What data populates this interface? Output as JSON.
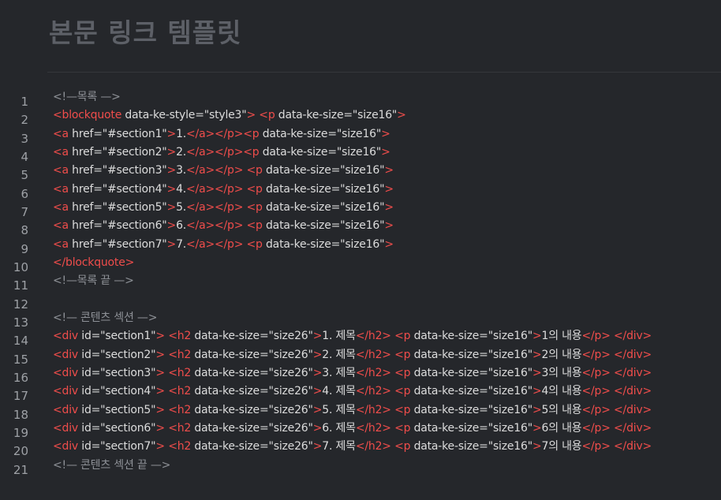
{
  "page": {
    "title": "본문 링크 템플릿"
  },
  "colors": {
    "background": "#25272b",
    "tag": "#f04d4b",
    "text": "#dcdcdc",
    "comment": "#8e9197",
    "line_number": "#9ea1a6",
    "title": "#5d6067"
  },
  "code": {
    "lines": [
      {
        "n": "1",
        "segs": [
          {
            "t": "<!—목록 —>",
            "k": "comment"
          }
        ]
      },
      {
        "n": "2",
        "segs": [
          {
            "t": "<blockquote",
            "k": "tag"
          },
          {
            "t": " data-ke-style=",
            "k": "attr"
          },
          {
            "t": "\"style3\"",
            "k": "val"
          },
          {
            "t": ">",
            "k": "tag"
          },
          {
            "t": " ",
            "k": "plain"
          },
          {
            "t": "<p",
            "k": "tag"
          },
          {
            "t": " data-ke-size=",
            "k": "attr"
          },
          {
            "t": "\"size16\"",
            "k": "val"
          },
          {
            "t": ">",
            "k": "tag"
          }
        ]
      },
      {
        "n": "3",
        "segs": [
          {
            "t": "<a",
            "k": "tag"
          },
          {
            "t": " href=",
            "k": "attr"
          },
          {
            "t": "\"#section1\"",
            "k": "val"
          },
          {
            "t": ">",
            "k": "tag"
          },
          {
            "t": "1.",
            "k": "plain"
          },
          {
            "t": "</a></p><p",
            "k": "tag"
          },
          {
            "t": " data-ke-size=",
            "k": "attr"
          },
          {
            "t": "\"size16\"",
            "k": "val"
          },
          {
            "t": ">",
            "k": "tag"
          }
        ]
      },
      {
        "n": "4",
        "segs": [
          {
            "t": "<a",
            "k": "tag"
          },
          {
            "t": " href=",
            "k": "attr"
          },
          {
            "t": "\"#section2\"",
            "k": "val"
          },
          {
            "t": ">",
            "k": "tag"
          },
          {
            "t": "2.",
            "k": "plain"
          },
          {
            "t": "</a></p><p",
            "k": "tag"
          },
          {
            "t": " data-ke-size=",
            "k": "attr"
          },
          {
            "t": "\"size16\"",
            "k": "val"
          },
          {
            "t": ">",
            "k": "tag"
          }
        ]
      },
      {
        "n": "5",
        "segs": [
          {
            "t": "<a",
            "k": "tag"
          },
          {
            "t": " href=",
            "k": "attr"
          },
          {
            "t": "\"#section3\"",
            "k": "val"
          },
          {
            "t": ">",
            "k": "tag"
          },
          {
            "t": "3.",
            "k": "plain"
          },
          {
            "t": "</a></p>",
            "k": "tag"
          },
          {
            "t": " ",
            "k": "plain"
          },
          {
            "t": "<p",
            "k": "tag"
          },
          {
            "t": " data-ke-size=",
            "k": "attr"
          },
          {
            "t": "\"size16\"",
            "k": "val"
          },
          {
            "t": ">",
            "k": "tag"
          }
        ]
      },
      {
        "n": "6",
        "segs": [
          {
            "t": "<a",
            "k": "tag"
          },
          {
            "t": " href=",
            "k": "attr"
          },
          {
            "t": "\"#section4\"",
            "k": "val"
          },
          {
            "t": ">",
            "k": "tag"
          },
          {
            "t": "4.",
            "k": "plain"
          },
          {
            "t": "</a></p>",
            "k": "tag"
          },
          {
            "t": " ",
            "k": "plain"
          },
          {
            "t": "<p",
            "k": "tag"
          },
          {
            "t": " data-ke-size=",
            "k": "attr"
          },
          {
            "t": "\"size16\"",
            "k": "val"
          },
          {
            "t": ">",
            "k": "tag"
          }
        ]
      },
      {
        "n": "7",
        "segs": [
          {
            "t": "<a",
            "k": "tag"
          },
          {
            "t": " href=",
            "k": "attr"
          },
          {
            "t": "\"#section5\"",
            "k": "val"
          },
          {
            "t": ">",
            "k": "tag"
          },
          {
            "t": "5.",
            "k": "plain"
          },
          {
            "t": "</a></p>",
            "k": "tag"
          },
          {
            "t": " ",
            "k": "plain"
          },
          {
            "t": "<p",
            "k": "tag"
          },
          {
            "t": " data-ke-size=",
            "k": "attr"
          },
          {
            "t": "\"size16\"",
            "k": "val"
          },
          {
            "t": ">",
            "k": "tag"
          }
        ]
      },
      {
        "n": "8",
        "segs": [
          {
            "t": "<a",
            "k": "tag"
          },
          {
            "t": " href=",
            "k": "attr"
          },
          {
            "t": "\"#section6\"",
            "k": "val"
          },
          {
            "t": ">",
            "k": "tag"
          },
          {
            "t": "6.",
            "k": "plain"
          },
          {
            "t": "</a></p>",
            "k": "tag"
          },
          {
            "t": " ",
            "k": "plain"
          },
          {
            "t": "<p",
            "k": "tag"
          },
          {
            "t": " data-ke-size=",
            "k": "attr"
          },
          {
            "t": "\"size16\"",
            "k": "val"
          },
          {
            "t": ">",
            "k": "tag"
          }
        ]
      },
      {
        "n": "9",
        "segs": [
          {
            "t": "<a",
            "k": "tag"
          },
          {
            "t": " href=",
            "k": "attr"
          },
          {
            "t": "\"#section7\"",
            "k": "val"
          },
          {
            "t": ">",
            "k": "tag"
          },
          {
            "t": "7.",
            "k": "plain"
          },
          {
            "t": "</a></p>",
            "k": "tag"
          },
          {
            "t": " ",
            "k": "plain"
          },
          {
            "t": "<p",
            "k": "tag"
          },
          {
            "t": " data-ke-size=",
            "k": "attr"
          },
          {
            "t": "\"size16\"",
            "k": "val"
          },
          {
            "t": ">",
            "k": "tag"
          }
        ]
      },
      {
        "n": "10",
        "segs": [
          {
            "t": "</blockquote>",
            "k": "tag"
          }
        ]
      },
      {
        "n": "11",
        "segs": [
          {
            "t": "<!—목록 끝 —>",
            "k": "comment"
          }
        ]
      },
      {
        "n": "12",
        "segs": []
      },
      {
        "n": "13",
        "segs": [
          {
            "t": "<!— 콘텐츠 섹션 —>",
            "k": "comment"
          }
        ]
      },
      {
        "n": "14",
        "segs": [
          {
            "t": "<div",
            "k": "tag"
          },
          {
            "t": " id=",
            "k": "attr"
          },
          {
            "t": "\"section1\"",
            "k": "val"
          },
          {
            "t": ">",
            "k": "tag"
          },
          {
            "t": " ",
            "k": "plain"
          },
          {
            "t": "<h2",
            "k": "tag"
          },
          {
            "t": " data-ke-size=",
            "k": "attr"
          },
          {
            "t": "\"size26\"",
            "k": "val"
          },
          {
            "t": ">",
            "k": "tag"
          },
          {
            "t": "1. 제목",
            "k": "plain"
          },
          {
            "t": "</h2>",
            "k": "tag"
          },
          {
            "t": " ",
            "k": "plain"
          },
          {
            "t": "<p",
            "k": "tag"
          },
          {
            "t": " data-ke-size=",
            "k": "attr"
          },
          {
            "t": "\"size16\"",
            "k": "val"
          },
          {
            "t": ">",
            "k": "tag"
          },
          {
            "t": "1의 내용",
            "k": "plain"
          },
          {
            "t": "</p>",
            "k": "tag"
          },
          {
            "t": " ",
            "k": "plain"
          },
          {
            "t": "</div>",
            "k": "tag"
          }
        ]
      },
      {
        "n": "15",
        "segs": [
          {
            "t": "<div",
            "k": "tag"
          },
          {
            "t": " id=",
            "k": "attr"
          },
          {
            "t": "\"section2\"",
            "k": "val"
          },
          {
            "t": ">",
            "k": "tag"
          },
          {
            "t": " ",
            "k": "plain"
          },
          {
            "t": "<h2",
            "k": "tag"
          },
          {
            "t": " data-ke-size=",
            "k": "attr"
          },
          {
            "t": "\"size26\"",
            "k": "val"
          },
          {
            "t": ">",
            "k": "tag"
          },
          {
            "t": "2. 제목",
            "k": "plain"
          },
          {
            "t": "</h2>",
            "k": "tag"
          },
          {
            "t": " ",
            "k": "plain"
          },
          {
            "t": "<p",
            "k": "tag"
          },
          {
            "t": " data-ke-size=",
            "k": "attr"
          },
          {
            "t": "\"size16\"",
            "k": "val"
          },
          {
            "t": ">",
            "k": "tag"
          },
          {
            "t": "2의 내용",
            "k": "plain"
          },
          {
            "t": "</p>",
            "k": "tag"
          },
          {
            "t": " ",
            "k": "plain"
          },
          {
            "t": "</div>",
            "k": "tag"
          }
        ]
      },
      {
        "n": "16",
        "segs": [
          {
            "t": "<div",
            "k": "tag"
          },
          {
            "t": " id=",
            "k": "attr"
          },
          {
            "t": "\"section3\"",
            "k": "val"
          },
          {
            "t": ">",
            "k": "tag"
          },
          {
            "t": " ",
            "k": "plain"
          },
          {
            "t": "<h2",
            "k": "tag"
          },
          {
            "t": " data-ke-size=",
            "k": "attr"
          },
          {
            "t": "\"size26\"",
            "k": "val"
          },
          {
            "t": ">",
            "k": "tag"
          },
          {
            "t": "3. 제목",
            "k": "plain"
          },
          {
            "t": "</h2>",
            "k": "tag"
          },
          {
            "t": " ",
            "k": "plain"
          },
          {
            "t": "<p",
            "k": "tag"
          },
          {
            "t": " data-ke-size=",
            "k": "attr"
          },
          {
            "t": "\"size16\"",
            "k": "val"
          },
          {
            "t": ">",
            "k": "tag"
          },
          {
            "t": "3의 내용",
            "k": "plain"
          },
          {
            "t": "</p>",
            "k": "tag"
          },
          {
            "t": " ",
            "k": "plain"
          },
          {
            "t": "</div>",
            "k": "tag"
          }
        ]
      },
      {
        "n": "17",
        "segs": [
          {
            "t": "<div",
            "k": "tag"
          },
          {
            "t": " id=",
            "k": "attr"
          },
          {
            "t": "\"section4\"",
            "k": "val"
          },
          {
            "t": ">",
            "k": "tag"
          },
          {
            "t": " ",
            "k": "plain"
          },
          {
            "t": "<h2",
            "k": "tag"
          },
          {
            "t": " data-ke-size=",
            "k": "attr"
          },
          {
            "t": "\"size26\"",
            "k": "val"
          },
          {
            "t": ">",
            "k": "tag"
          },
          {
            "t": "4. 제목",
            "k": "plain"
          },
          {
            "t": "</h2>",
            "k": "tag"
          },
          {
            "t": " ",
            "k": "plain"
          },
          {
            "t": "<p",
            "k": "tag"
          },
          {
            "t": " data-ke-size=",
            "k": "attr"
          },
          {
            "t": "\"size16\"",
            "k": "val"
          },
          {
            "t": ">",
            "k": "tag"
          },
          {
            "t": "4의 내용",
            "k": "plain"
          },
          {
            "t": "</p>",
            "k": "tag"
          },
          {
            "t": " ",
            "k": "plain"
          },
          {
            "t": "</div>",
            "k": "tag"
          }
        ]
      },
      {
        "n": "18",
        "segs": [
          {
            "t": "<div",
            "k": "tag"
          },
          {
            "t": " id=",
            "k": "attr"
          },
          {
            "t": "\"section5\"",
            "k": "val"
          },
          {
            "t": ">",
            "k": "tag"
          },
          {
            "t": " ",
            "k": "plain"
          },
          {
            "t": "<h2",
            "k": "tag"
          },
          {
            "t": " data-ke-size=",
            "k": "attr"
          },
          {
            "t": "\"size26\"",
            "k": "val"
          },
          {
            "t": ">",
            "k": "tag"
          },
          {
            "t": "5. 제목",
            "k": "plain"
          },
          {
            "t": "</h2>",
            "k": "tag"
          },
          {
            "t": " ",
            "k": "plain"
          },
          {
            "t": "<p",
            "k": "tag"
          },
          {
            "t": " data-ke-size=",
            "k": "attr"
          },
          {
            "t": "\"size16\"",
            "k": "val"
          },
          {
            "t": ">",
            "k": "tag"
          },
          {
            "t": "5의 내용",
            "k": "plain"
          },
          {
            "t": "</p>",
            "k": "tag"
          },
          {
            "t": " ",
            "k": "plain"
          },
          {
            "t": "</div>",
            "k": "tag"
          }
        ]
      },
      {
        "n": "19",
        "segs": [
          {
            "t": "<div",
            "k": "tag"
          },
          {
            "t": " id=",
            "k": "attr"
          },
          {
            "t": "\"section6\"",
            "k": "val"
          },
          {
            "t": ">",
            "k": "tag"
          },
          {
            "t": " ",
            "k": "plain"
          },
          {
            "t": "<h2",
            "k": "tag"
          },
          {
            "t": " data-ke-size=",
            "k": "attr"
          },
          {
            "t": "\"size26\"",
            "k": "val"
          },
          {
            "t": ">",
            "k": "tag"
          },
          {
            "t": "6. 제목",
            "k": "plain"
          },
          {
            "t": "</h2>",
            "k": "tag"
          },
          {
            "t": " ",
            "k": "plain"
          },
          {
            "t": "<p",
            "k": "tag"
          },
          {
            "t": " data-ke-size=",
            "k": "attr"
          },
          {
            "t": "\"size16\"",
            "k": "val"
          },
          {
            "t": ">",
            "k": "tag"
          },
          {
            "t": "6의 내용",
            "k": "plain"
          },
          {
            "t": "</p>",
            "k": "tag"
          },
          {
            "t": " ",
            "k": "plain"
          },
          {
            "t": "</div>",
            "k": "tag"
          }
        ]
      },
      {
        "n": "20",
        "segs": [
          {
            "t": "<div",
            "k": "tag"
          },
          {
            "t": " id=",
            "k": "attr"
          },
          {
            "t": "\"section7\"",
            "k": "val"
          },
          {
            "t": ">",
            "k": "tag"
          },
          {
            "t": " ",
            "k": "plain"
          },
          {
            "t": "<h2",
            "k": "tag"
          },
          {
            "t": " data-ke-size=",
            "k": "attr"
          },
          {
            "t": "\"size26\"",
            "k": "val"
          },
          {
            "t": ">",
            "k": "tag"
          },
          {
            "t": "7. 제목",
            "k": "plain"
          },
          {
            "t": "</h2>",
            "k": "tag"
          },
          {
            "t": " ",
            "k": "plain"
          },
          {
            "t": "<p",
            "k": "tag"
          },
          {
            "t": " data-ke-size=",
            "k": "attr"
          },
          {
            "t": "\"size16\"",
            "k": "val"
          },
          {
            "t": ">",
            "k": "tag"
          },
          {
            "t": "7의 내용",
            "k": "plain"
          },
          {
            "t": "</p>",
            "k": "tag"
          },
          {
            "t": " ",
            "k": "plain"
          },
          {
            "t": "</div>",
            "k": "tag"
          }
        ]
      },
      {
        "n": "21",
        "segs": [
          {
            "t": "<!— 콘텐츠 섹션 끝 —>",
            "k": "comment"
          }
        ]
      }
    ]
  }
}
